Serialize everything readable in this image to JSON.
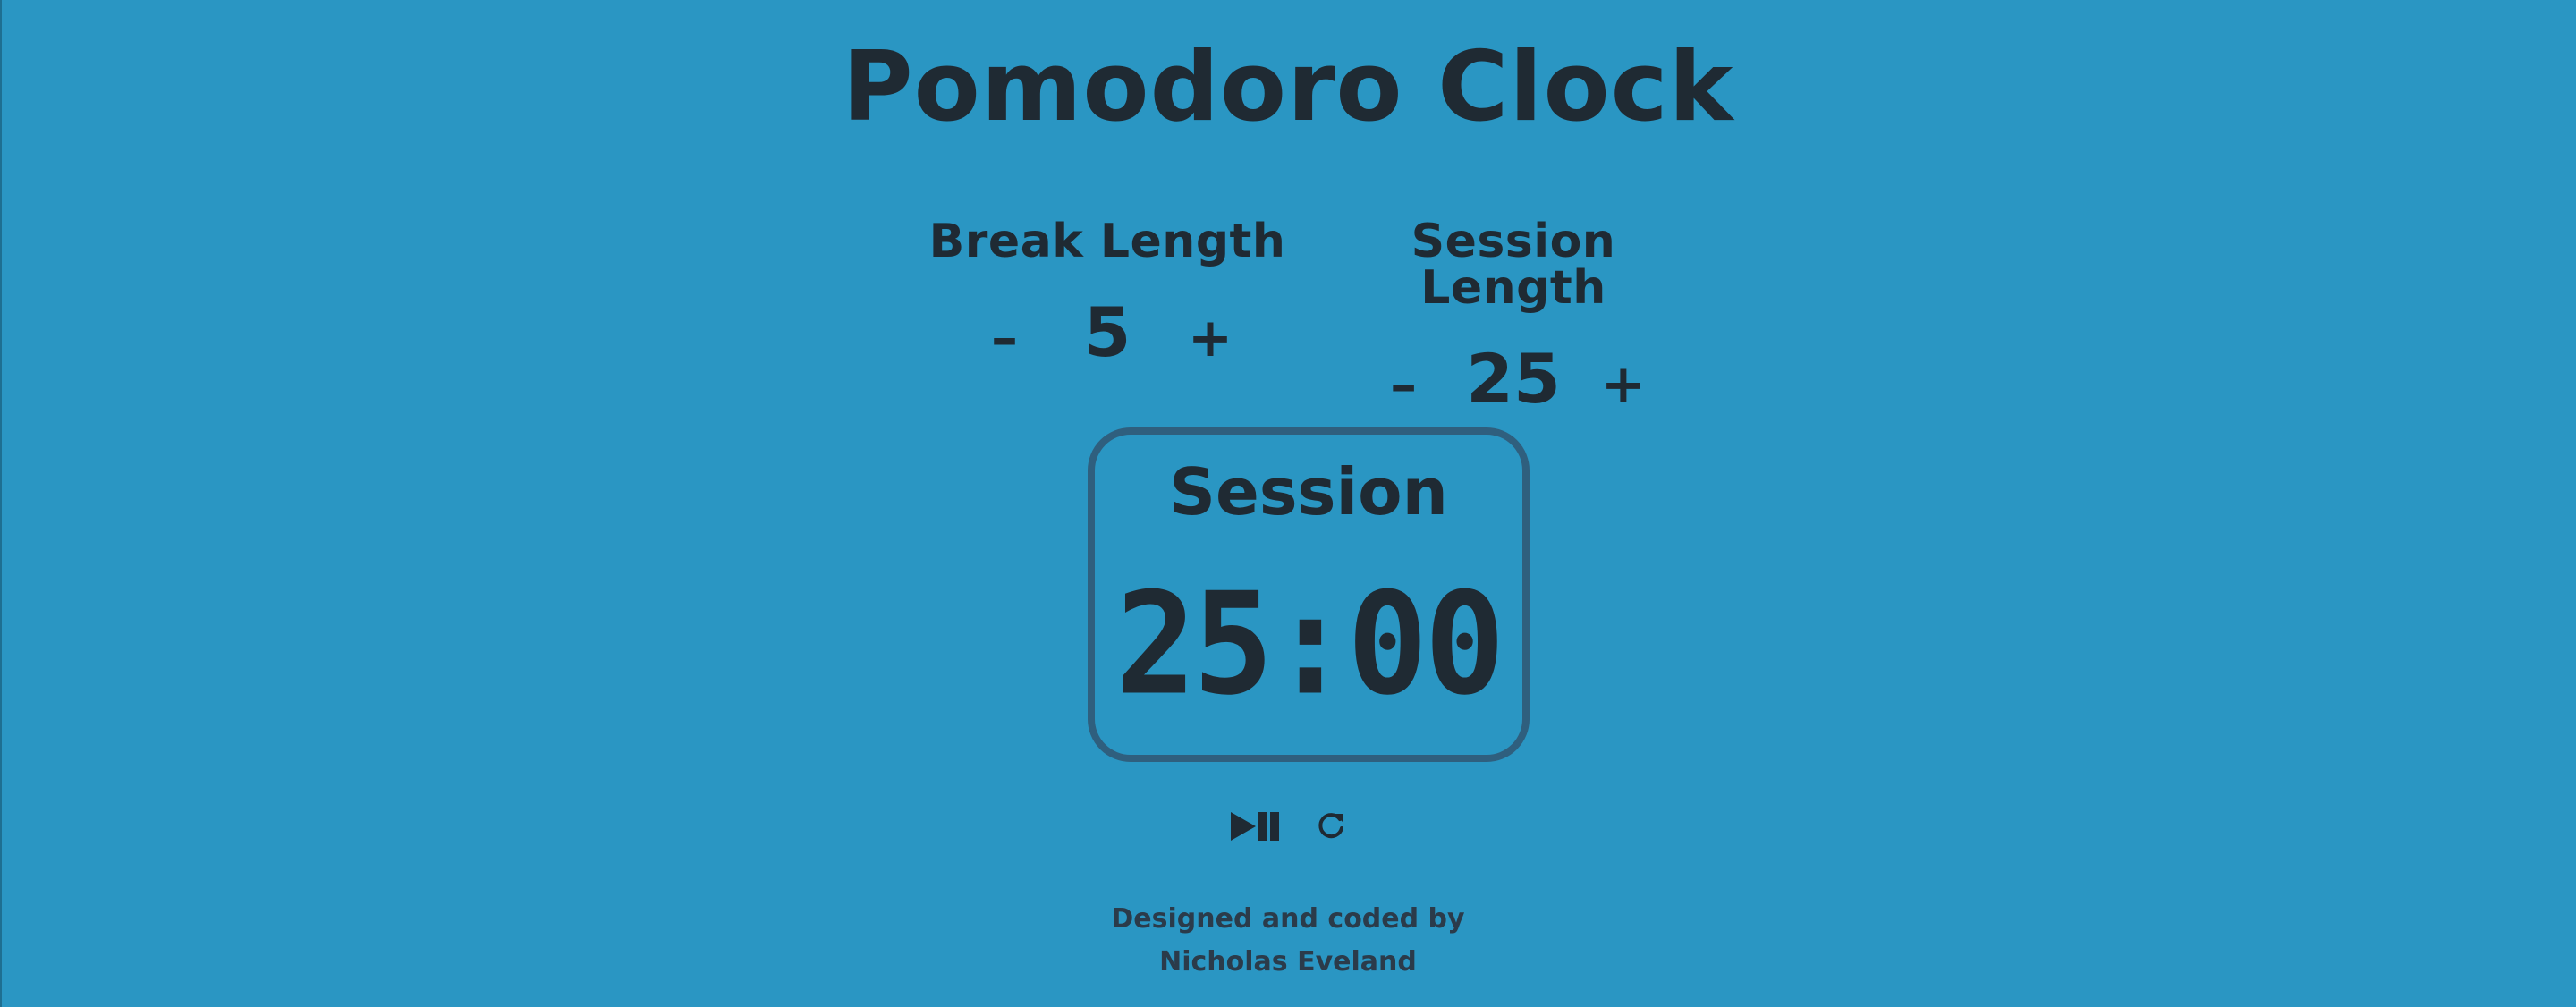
{
  "title": "Pomodoro Clock",
  "break": {
    "label": "Break Length",
    "decrement": "–",
    "value": "5",
    "increment": "+"
  },
  "session": {
    "label": "Session Length",
    "decrement": "–",
    "value": "25",
    "increment": "+"
  },
  "timer": {
    "label": "Session",
    "display": "25:00"
  },
  "actions": {
    "play_pause_icon": "play-pause-icon",
    "reset_icon": "refresh-icon"
  },
  "footer": {
    "line1": "Designed and coded by",
    "line2": "Nicholas Eveland"
  },
  "colors": {
    "background": "#2a96c3",
    "text": "#1f2a33",
    "timer_border": "#2f5f7e"
  }
}
